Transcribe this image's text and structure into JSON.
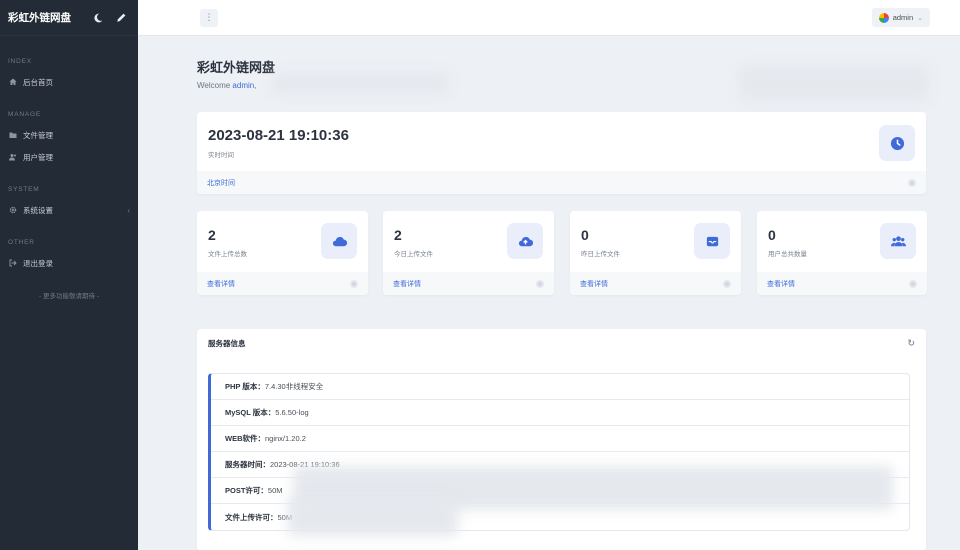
{
  "app": {
    "title": "彩虹外链网盘",
    "colors": {
      "sidebar": "#222b36",
      "accent": "#3f6ad8",
      "background": "#edf0f5"
    }
  },
  "sidebar": {
    "sections": [
      {
        "label": "INDEX",
        "items": [
          {
            "label": "后台首页",
            "icon": "home-icon"
          }
        ]
      },
      {
        "label": "MANAGE",
        "items": [
          {
            "label": "文件管理",
            "icon": "folder-icon"
          },
          {
            "label": "用户管理",
            "icon": "users-icon"
          }
        ]
      },
      {
        "label": "SYSTEM",
        "items": [
          {
            "label": "系统设置",
            "icon": "gear-icon"
          }
        ]
      },
      {
        "label": "OTHER",
        "items": [
          {
            "label": "退出登录",
            "icon": "logout-icon"
          }
        ]
      }
    ],
    "more_text": "- 更多功能敬请期待 -"
  },
  "topbar": {
    "menu_icon": "⋮",
    "user_label": "admin"
  },
  "hero": {
    "title": "彩虹外链网盘",
    "welcome_prefix": "Welcome ",
    "user": "admin",
    "welcome_suffix": ","
  },
  "time_card": {
    "value": "2023-08-21 19:10:36",
    "caption": "实时时间",
    "footer": "北京时间",
    "icon": "clock-icon"
  },
  "stats": [
    {
      "value": "2",
      "caption": "文件上传总数",
      "footer": "查看详情",
      "icon": "cloud-icon"
    },
    {
      "value": "2",
      "caption": "今日上传文件",
      "footer": "查看详情",
      "icon": "cloud-upload-icon"
    },
    {
      "value": "0",
      "caption": "昨日上传文件",
      "footer": "查看详情",
      "icon": "inbox-icon"
    },
    {
      "value": "0",
      "caption": "用户总共数量",
      "footer": "查看详情",
      "icon": "users-icon"
    }
  ],
  "server_info": {
    "title": "服务器信息",
    "rows": [
      {
        "key": "PHP 版本：",
        "value": "7.4.30非线程安全"
      },
      {
        "key": "MySQL 版本：",
        "value": "5.6.50-log"
      },
      {
        "key": "WEB软件：",
        "value": "nginx/1.20.2"
      },
      {
        "key": "服务器时间：",
        "value": "2023-08-21 19:10:36"
      },
      {
        "key": "POST许可：",
        "value": "50M"
      },
      {
        "key": "文件上传许可：",
        "value": "50M"
      }
    ]
  }
}
